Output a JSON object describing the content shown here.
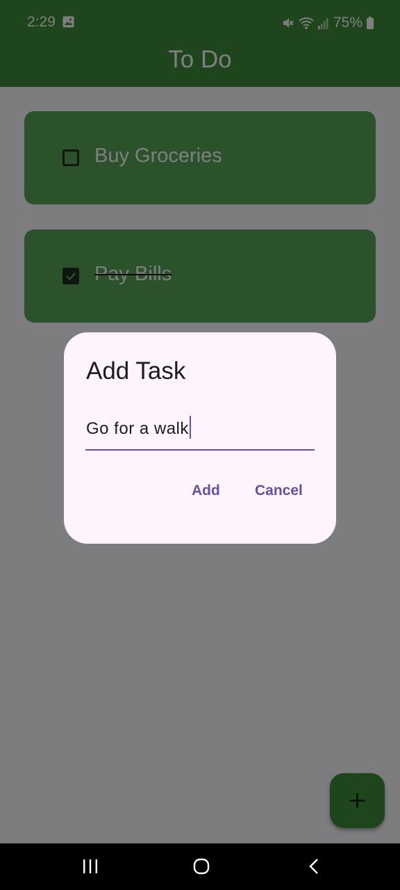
{
  "status_bar": {
    "time": "2:29",
    "battery": "75%"
  },
  "app": {
    "title": "To Do"
  },
  "tasks": [
    {
      "label": "Buy Groceries",
      "done": false
    },
    {
      "label": "Pay Bills",
      "done": true
    }
  ],
  "dialog": {
    "title": "Add Task",
    "input_value": "Go for a walk",
    "add_label": "Add",
    "cancel_label": "Cancel"
  },
  "fab": {
    "icon": "plus-icon"
  },
  "colors": {
    "primary_green": "#3f8a3a",
    "card_green": "#57a555",
    "dialog_bg": "#fdf4fd",
    "accent_purple": "#6a4fa0"
  }
}
